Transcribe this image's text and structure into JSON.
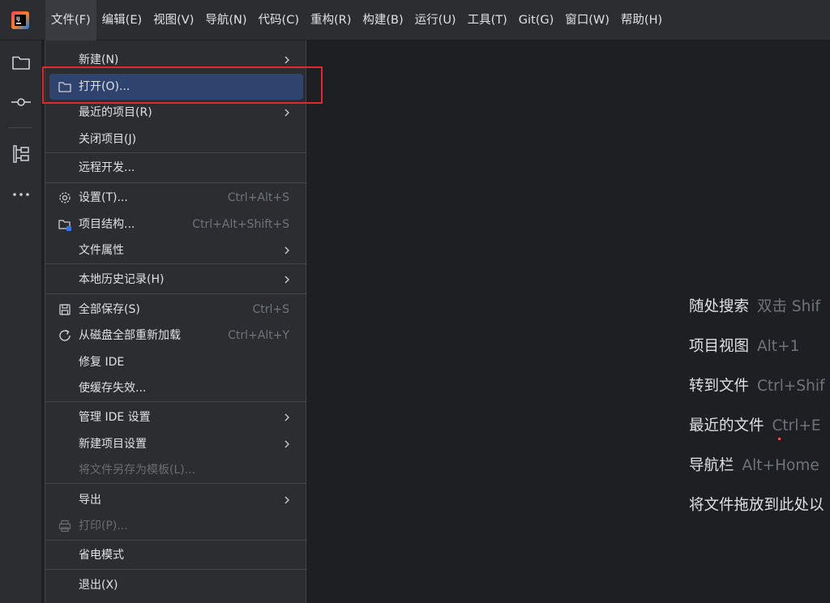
{
  "menubar": {
    "items": [
      "文件(F)",
      "编辑(E)",
      "视图(V)",
      "导航(N)",
      "代码(C)",
      "重构(R)",
      "构建(B)",
      "运行(U)",
      "工具(T)",
      "Git(G)",
      "窗口(W)",
      "帮助(H)"
    ],
    "active_index": 0
  },
  "toolstrip": {
    "icons": [
      "folder-icon",
      "commit-icon",
      "structure-icon",
      "more-icon"
    ]
  },
  "file_menu": {
    "items": [
      {
        "label": "新建(N)",
        "shortcut": "",
        "submenu": true,
        "icon": ""
      },
      {
        "label": "打开(O)...",
        "shortcut": "",
        "submenu": false,
        "icon": "folder-icon",
        "selected": true
      },
      {
        "label": "最近的项目(R)",
        "shortcut": "",
        "submenu": true,
        "icon": ""
      },
      {
        "label": "关闭项目(J)",
        "shortcut": "",
        "submenu": false,
        "icon": ""
      },
      {
        "label": "远程开发...",
        "shortcut": "",
        "submenu": false,
        "icon": ""
      },
      {
        "label": "设置(T)...",
        "shortcut": "Ctrl+Alt+S",
        "submenu": false,
        "icon": "gear-icon"
      },
      {
        "label": "项目结构...",
        "shortcut": "Ctrl+Alt+Shift+S",
        "submenu": false,
        "icon": "project-structure-icon"
      },
      {
        "label": "文件属性",
        "shortcut": "",
        "submenu": true,
        "icon": ""
      },
      {
        "label": "本地历史记录(H)",
        "shortcut": "",
        "submenu": true,
        "icon": ""
      },
      {
        "label": "全部保存(S)",
        "shortcut": "Ctrl+S",
        "submenu": false,
        "icon": "save-icon"
      },
      {
        "label": "从磁盘全部重新加载",
        "shortcut": "Ctrl+Alt+Y",
        "submenu": false,
        "icon": "reload-icon"
      },
      {
        "label": "修复 IDE",
        "shortcut": "",
        "submenu": false,
        "icon": ""
      },
      {
        "label": "使缓存失效...",
        "shortcut": "",
        "submenu": false,
        "icon": ""
      },
      {
        "label": "管理 IDE 设置",
        "shortcut": "",
        "submenu": true,
        "icon": ""
      },
      {
        "label": "新建项目设置",
        "shortcut": "",
        "submenu": true,
        "icon": ""
      },
      {
        "label": "将文件另存为模板(L)...",
        "shortcut": "",
        "submenu": false,
        "icon": "",
        "disabled": true
      },
      {
        "label": "导出",
        "shortcut": "",
        "submenu": true,
        "icon": ""
      },
      {
        "label": "打印(P)...",
        "shortcut": "",
        "submenu": false,
        "icon": "print-icon",
        "disabled": true
      },
      {
        "label": "省电模式",
        "shortcut": "",
        "submenu": false,
        "icon": ""
      },
      {
        "label": "退出(X)",
        "shortcut": "",
        "submenu": false,
        "icon": ""
      }
    ]
  },
  "hints": [
    {
      "label": "随处搜索",
      "keys": "双击 Shif"
    },
    {
      "label": "项目视图",
      "keys": "Alt+1"
    },
    {
      "label": "转到文件",
      "keys": "Ctrl+Shif"
    },
    {
      "label": "最近的文件",
      "keys": "Ctrl+E"
    },
    {
      "label": "导航栏",
      "keys": "Alt+Home"
    },
    {
      "label": "将文件拖放到此处以",
      "keys": ""
    }
  ],
  "colors": {
    "background": "#1e1f22",
    "panel": "#2b2d30",
    "selection": "#2e436e",
    "highlight_border": "#e0282e",
    "muted_text": "#6f737a"
  }
}
